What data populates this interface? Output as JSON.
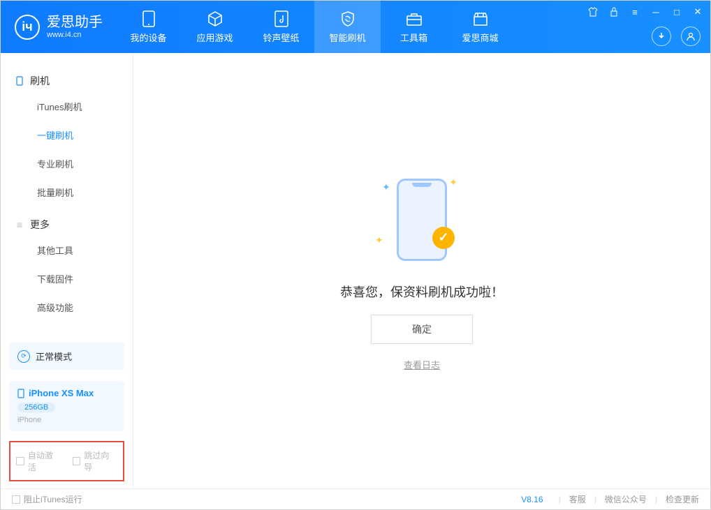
{
  "app": {
    "name": "爱思助手",
    "url": "www.i4.cn"
  },
  "tabs": {
    "device": "我的设备",
    "apps": "应用游戏",
    "ringtones": "铃声壁纸",
    "flash": "智能刷机",
    "toolbox": "工具箱",
    "store": "爱思商城"
  },
  "sidebar": {
    "flash_section": "刷机",
    "items": {
      "itunes": "iTunes刷机",
      "oneclick": "一键刷机",
      "pro": "专业刷机",
      "batch": "批量刷机"
    },
    "more_section": "更多",
    "more": {
      "other": "其他工具",
      "firmware": "下载固件",
      "advanced": "高级功能"
    }
  },
  "device": {
    "mode": "正常模式",
    "name": "iPhone XS Max",
    "capacity": "256GB",
    "type": "iPhone"
  },
  "checkboxes": {
    "auto_activate": "自动激活",
    "skip_guide": "跳过向导",
    "block_itunes": "阻止iTunes运行"
  },
  "content": {
    "success": "恭喜您，保资料刷机成功啦！",
    "confirm": "确定",
    "view_log": "查看日志"
  },
  "footer": {
    "version": "V8.16",
    "support": "客服",
    "wechat": "微信公众号",
    "update": "检查更新"
  }
}
